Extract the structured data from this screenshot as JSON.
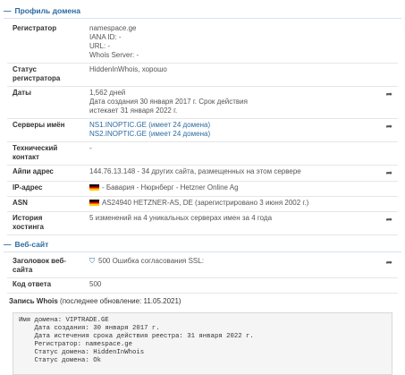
{
  "sections": {
    "profile": {
      "title": "Профиль домена"
    },
    "website": {
      "title": "Веб-сайт"
    }
  },
  "profile_rows": {
    "registrar": {
      "label": "Регистратор",
      "lines": [
        "namespace.ge",
        "IANA ID: -",
        "URL: -",
        "Whois Server: -"
      ]
    },
    "status": {
      "label_line1": "Статус",
      "label_line2": "регистратора",
      "value": "HiddenInWhois, хорошо"
    },
    "dates": {
      "label": "Даты",
      "lines": [
        "1,562 дней",
        "Дата создания 30 января 2017 г. Срок действия",
        "истекает 31 января 2022 г."
      ]
    },
    "nameservers": {
      "label": "Серверы имён",
      "lines": [
        "NS1.INOPTIC.GE (имеет 24 домена)",
        "NS2.INOPTIC.GE (имеет 24 домена)"
      ]
    },
    "tech": {
      "label_line1": "Технический",
      "label_line2": "контакт",
      "value": "-"
    },
    "ip": {
      "label": "Айпи адрес",
      "value": "144.76.13.148 - 34 других сайта, размещенных на этом сервере"
    },
    "ip_location": {
      "label": "IP-адрес",
      "value": "- Бавария - Нюрнберг - Hetzner Online Ag"
    },
    "asn": {
      "label": "ASN",
      "value": "AS24940 HETZNER-AS, DE (зарегистрировано 3 июня 2002 г.)"
    },
    "history": {
      "label_line1": "История",
      "label_line2": "хостинга",
      "value": "5 изменений на 4 уникальных серверах имен за 4 года"
    }
  },
  "website_rows": {
    "header": {
      "label_line1": "Заголовок веб-",
      "label_line2": "сайта",
      "value": "500 Ошибка согласования SSL:"
    },
    "response": {
      "label": "Код ответа",
      "value": "500"
    }
  },
  "whois": {
    "title": "Запись Whois",
    "updated": "(последнее обновление: 11.05.2021)",
    "lines": [
      "Имя домена: VIPTRADE.GE",
      "    Дата создания: 30 января 2017 г.",
      "    Дата истечения срока действия реестра: 31 января 2022 г.",
      "    Регистратор: namespace.ge",
      "    Статус домена: HiddenInWhois",
      "    Статус домена: Ok"
    ]
  },
  "icons": {
    "share": "share-arrow-icon",
    "flag": "germany-flag-icon",
    "ssl": "shield-icon"
  }
}
